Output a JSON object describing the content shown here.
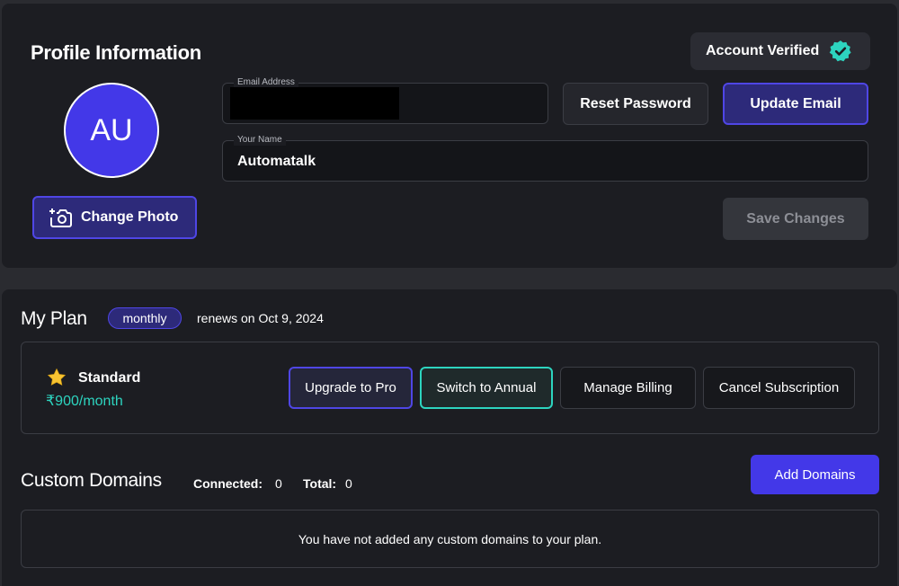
{
  "profile": {
    "title": "Profile Information",
    "verified_label": "Account Verified",
    "avatar_initials": "AU",
    "change_photo_label": "Change Photo",
    "email": {
      "label": "Email Address",
      "value": ""
    },
    "name": {
      "label": "Your Name",
      "value": "Automatalk"
    },
    "reset_password_label": "Reset Password",
    "update_email_label": "Update Email",
    "save_changes_label": "Save Changes"
  },
  "plan": {
    "title": "My Plan",
    "cycle_badge": "monthly",
    "renews_text": "renews on Oct 9, 2024",
    "name": "Standard",
    "price": "₹900/month",
    "buttons": {
      "upgrade": "Upgrade to Pro",
      "annual": "Switch to Annual",
      "billing": "Manage Billing",
      "cancel": "Cancel Subscription"
    }
  },
  "domains": {
    "title": "Custom Domains",
    "connected_label": "Connected:",
    "connected_value": "0",
    "total_label": "Total:",
    "total_value": "0",
    "add_label": "Add Domains",
    "empty_text": "You have not added any custom domains to your plan."
  },
  "colors": {
    "accent": "#4338e8",
    "accent_border": "#4f46e5",
    "teal": "#2dd4bf",
    "verified": "#2dd4bf"
  },
  "icons": {
    "verified": "verified-badge-icon",
    "camera": "add-camera-icon",
    "star": "star-icon"
  }
}
